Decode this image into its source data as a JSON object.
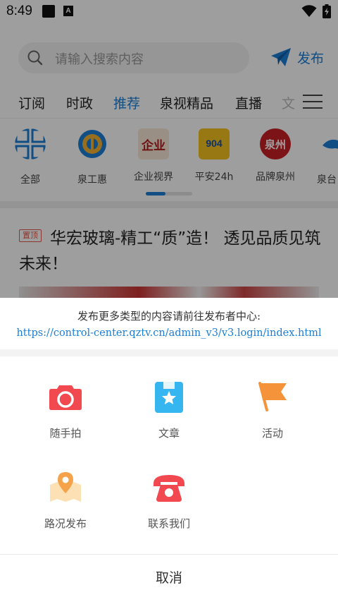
{
  "status_bar": {
    "time": "8:49",
    "icons": [
      "notification-square-icon",
      "a-badge-icon",
      "wifi-icon",
      "battery-charging-icon"
    ],
    "a_badge": "A"
  },
  "search": {
    "placeholder": "请输入搜索内容",
    "publish_label": "发布"
  },
  "tabs": [
    {
      "label": "订阅"
    },
    {
      "label": "时政"
    },
    {
      "label": "推荐",
      "active": true
    },
    {
      "label": "泉视精品"
    },
    {
      "label": "直播"
    },
    {
      "label": "文"
    }
  ],
  "channels": [
    {
      "label": "全部",
      "icon": "grid-icon"
    },
    {
      "label": "泉工惠",
      "icon": "union-badge-icon"
    },
    {
      "label": "企业视界",
      "icon": "enterprise-icon",
      "logo_text": "企业"
    },
    {
      "label": "平安24h",
      "icon": "pingan-icon",
      "logo_text": "904"
    },
    {
      "label": "品牌泉州",
      "icon": "quanzhou-brand-icon",
      "logo_text": "泉州"
    },
    {
      "label": "泉台",
      "icon": "whale-icon"
    }
  ],
  "news": {
    "pin_badge": "置顶",
    "headline": "华宏玻璃-精工“质”造！ 透见品质见筑未来！"
  },
  "sheet": {
    "notice": "发布更多类型的内容请前往发布者中心:",
    "link": "https://control-center.qztv.cn/admin_v3/v3.login/index.html",
    "options": [
      {
        "label": "随手拍",
        "icon": "camera-icon",
        "color": "#f2484f"
      },
      {
        "label": "文章",
        "icon": "article-star-icon",
        "color": "#35b6f0"
      },
      {
        "label": "活动",
        "icon": "flag-icon",
        "color": "#f5933a"
      },
      {
        "label": "路况发布",
        "icon": "map-pin-icon",
        "color": "#f5a34a"
      },
      {
        "label": "联系我们",
        "icon": "telephone-icon",
        "color": "#f2484f"
      }
    ],
    "cancel": "取消"
  },
  "colors": {
    "accent": "#1a7ed6",
    "overlay": "rgba(0,0,0,0.38)"
  }
}
